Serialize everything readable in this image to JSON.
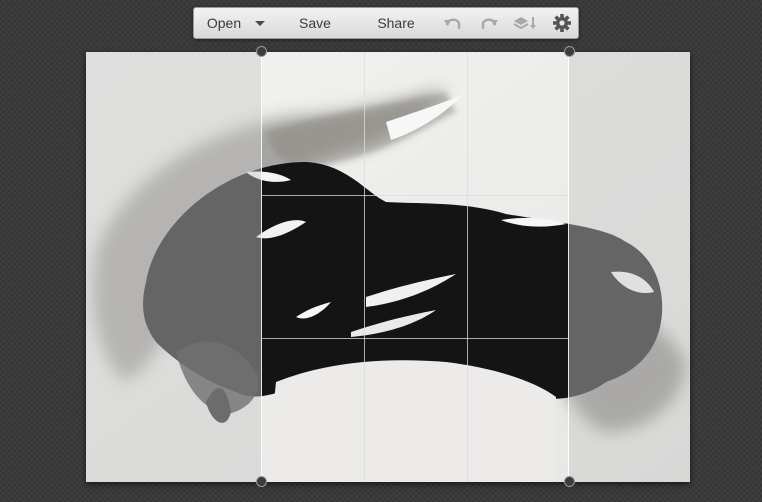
{
  "toolbar": {
    "open_label": "Open",
    "save_label": "Save",
    "share_label": "Share",
    "icons": {
      "dropdown": "caret-down-icon",
      "undo": "undo-icon",
      "redo": "redo-icon",
      "layers": "layers-icon",
      "settings": "gear-icon"
    }
  },
  "colors": {
    "toolbar_text": "#3b3b3b",
    "disabled_icon": "#9a9a9a",
    "background": "#3a3a3a",
    "ink": "#111111",
    "paper": "#eeeeee"
  }
}
